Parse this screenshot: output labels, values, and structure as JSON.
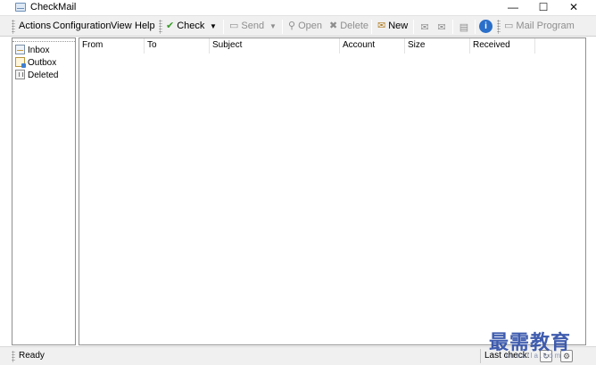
{
  "window": {
    "title": "CheckMail",
    "controls": {
      "minimize": "—",
      "maximize": "☐",
      "close": "✕"
    }
  },
  "menu": {
    "items": [
      {
        "label": "Actions"
      },
      {
        "label": "Configuration"
      },
      {
        "label": "View"
      },
      {
        "label": "Help"
      }
    ]
  },
  "toolbar": {
    "check_label": "Check",
    "send_label": "Send",
    "open_label": "Open",
    "delete_label": "Delete",
    "new_label": "New",
    "mail_program_label": "Mail Program",
    "dropdown_arrow": "▼",
    "icons": {
      "check": "✔",
      "send": "▭",
      "open": "⚲",
      "delete": "✖",
      "new": "✉",
      "mail_program": "▭",
      "extra1": "✉",
      "extra2": "✉",
      "extra3": "▤",
      "info": "i"
    }
  },
  "folders": [
    {
      "label": "Inbox",
      "icon": "inbox-icon"
    },
    {
      "label": "Outbox",
      "icon": "outbox-icon"
    },
    {
      "label": "Deleted",
      "icon": "trash-icon"
    }
  ],
  "message_list": {
    "columns": [
      "From",
      "To",
      "Subject",
      "Account",
      "Size",
      "Received"
    ]
  },
  "status": {
    "left": "Ready",
    "right": "Last check:"
  },
  "watermark": {
    "text": "最需教育",
    "sub": "xuexila.com"
  },
  "colors": {
    "check_icon": "#3a9a2a",
    "info_icon": "#2a6fc9",
    "watermark": "#2f4fa8"
  }
}
